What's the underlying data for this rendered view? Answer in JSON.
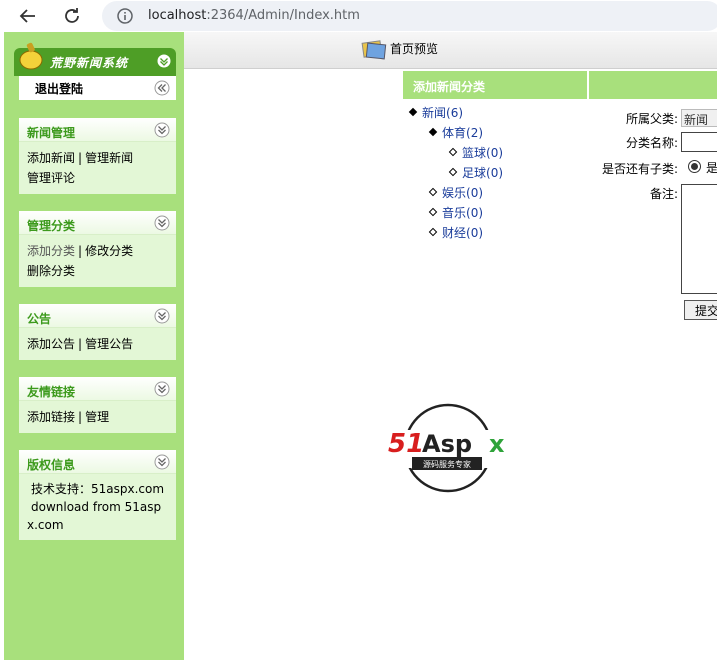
{
  "browser": {
    "url_host": "localhost",
    "url_rest": ":2364/Admin/Index.htm"
  },
  "sidebar": {
    "title": "荒野新闻系统",
    "logout": "退出登陆",
    "panels": [
      {
        "title": "新闻管理",
        "lines": [
          [
            "添加新闻",
            "管理新闻"
          ],
          [
            "管理评论"
          ]
        ]
      },
      {
        "title": "管理分类",
        "lines": [
          [
            "添加分类",
            "修改分类"
          ],
          [
            "删除分类"
          ]
        ]
      },
      {
        "title": "公告",
        "lines": [
          [
            "添加公告",
            "管理公告"
          ]
        ]
      },
      {
        "title": "友情链接",
        "lines": [
          [
            "添加链接",
            "管理"
          ]
        ]
      },
      {
        "title": "版权信息",
        "text": [
          "技术支持：51aspx.com",
          "download from 51asp",
          "x.com"
        ]
      }
    ]
  },
  "topbar": {
    "label": "首页预览"
  },
  "section": {
    "title": "添加新闻分类"
  },
  "tree": [
    {
      "label": "新闻",
      "count": "(6)"
    },
    {
      "label": "体育",
      "count": "(2)"
    },
    {
      "label": "篮球",
      "count": "(0)"
    },
    {
      "label": "足球",
      "count": "(0)"
    },
    {
      "label": "娱乐",
      "count": "(0)"
    },
    {
      "label": "音乐",
      "count": "(0)"
    },
    {
      "label": "财经",
      "count": "(0)"
    }
  ],
  "form": {
    "parent_label": "所属父类:",
    "parent_value": "新闻",
    "name_label": "分类名称:",
    "has_child_label": "是否还有子类:",
    "has_child_value": "是",
    "note_label": "备注:",
    "submit": "提交"
  },
  "watermark": {
    "brand": "51Aspx",
    "tagline": "源码服务专家"
  }
}
